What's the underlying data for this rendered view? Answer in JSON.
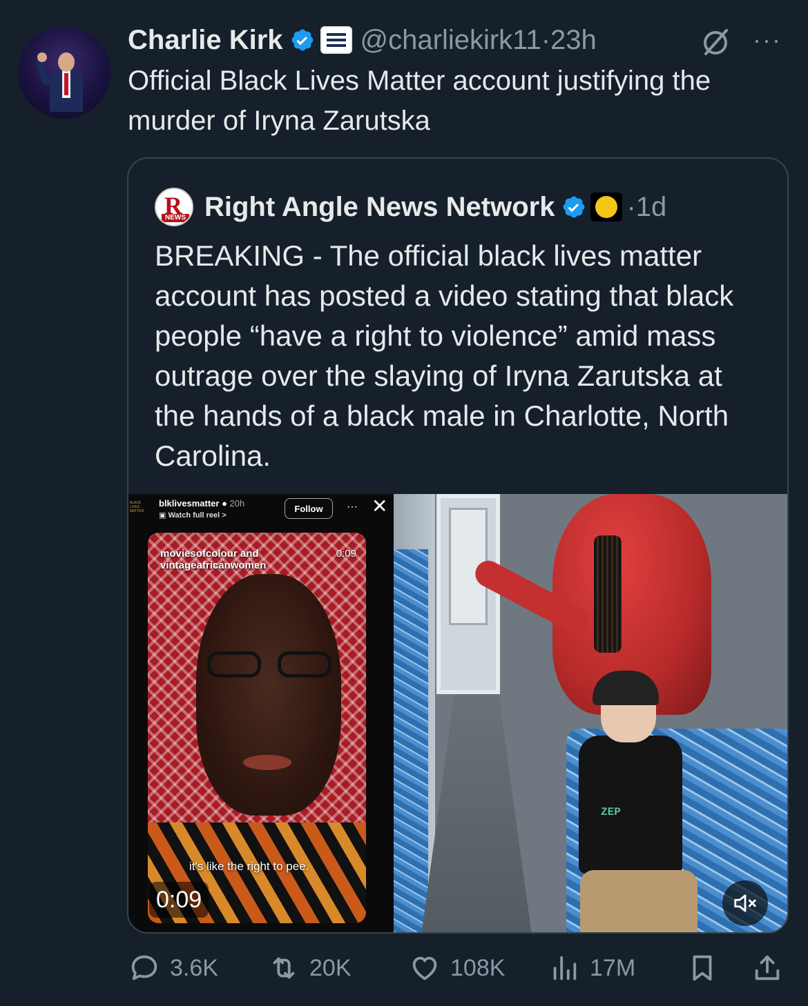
{
  "tweet": {
    "author_name": "Charlie Kirk",
    "handle": "@charliekirk11",
    "separator": "·",
    "time": "23h",
    "handle_time": "@charliekirk11·23h",
    "text": "Official Black Lives Matter account justifying the murder of Iryna Zarutska"
  },
  "quoted": {
    "author_name": "Right Angle News Network",
    "time": "·1d",
    "avatar_letter": "R",
    "avatar_label": "NEWS",
    "text": "BREAKING - The official black lives matter account has posted a video stating that black people “have a right to violence” amid mass outrage over the slaying of Iryna Zarutska at the hands of a black male in Charlotte, North Carolina."
  },
  "media": {
    "ig_logo_lines": [
      "BLACK",
      "LIVES",
      "MATTER"
    ],
    "ig_username": "blklivesmatter",
    "ig_time": "20h",
    "ig_watch": "Watch full reel >",
    "ig_follow": "Follow",
    "ig_dots": "···",
    "ig_close": "✕",
    "reel_username_line1": "moviesofcolour and",
    "reel_username_line2": "vintageafricanwomen",
    "reel_time": "0:09",
    "reel_caption": "it's like the right to pee.",
    "duration": "0:09",
    "victim_shirt_text": "ZEP"
  },
  "actions": {
    "replies": "3.6K",
    "reposts": "20K",
    "likes": "108K",
    "views": "17M"
  },
  "colors": {
    "background": "#15202b",
    "text_primary": "#e7e9ea",
    "text_secondary": "#8b98a5",
    "verified": "#1d9bf0",
    "border": "#38444d"
  },
  "icons": {
    "verified": "verified-badge-icon",
    "grok": "grok-icon",
    "more": "more-dots-icon",
    "reply": "reply-icon",
    "repost": "repost-icon",
    "like": "heart-icon",
    "views": "views-chart-icon",
    "bookmark": "bookmark-icon",
    "share": "share-icon",
    "mute": "muted-speaker-icon"
  }
}
